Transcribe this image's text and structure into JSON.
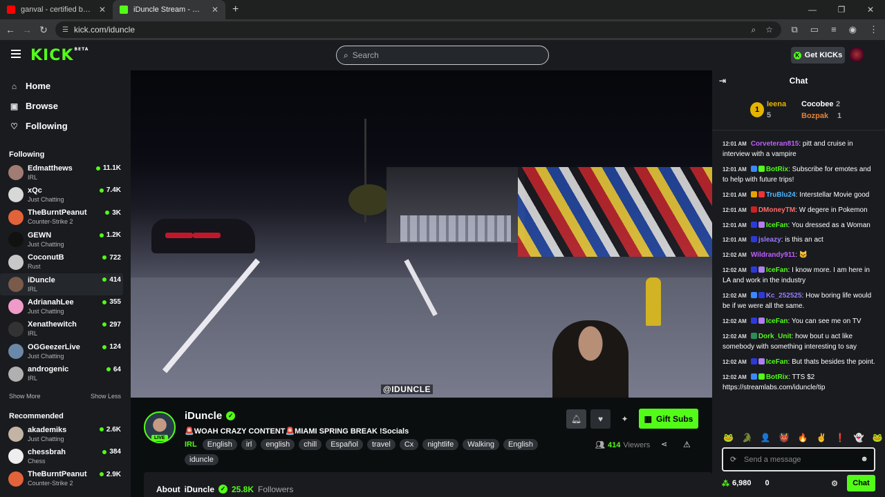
{
  "browser": {
    "tabs": [
      {
        "title": "ganval - certified boogeyman",
        "fav": "#ff0000"
      },
      {
        "title": "iDuncle Stream - Watch Live",
        "fav": "#53fc18"
      }
    ],
    "url": "kick.com/iduncle"
  },
  "header": {
    "logo": "KICK",
    "beta": "BETA",
    "search_placeholder": "Search",
    "get_kicks": "Get KICKs"
  },
  "sidebar": {
    "nav": [
      {
        "label": "Home",
        "icon": "home-icon"
      },
      {
        "label": "Browse",
        "icon": "browse-icon"
      },
      {
        "label": "Following",
        "icon": "heart-icon"
      }
    ],
    "following_title": "Following",
    "following": [
      {
        "name": "Edmatthews",
        "game": "IRL",
        "viewers": "11.1K",
        "color": "#a07c72"
      },
      {
        "name": "xQc",
        "game": "Just Chatting",
        "viewers": "7.4K",
        "color": "#d8d8d8"
      },
      {
        "name": "TheBurntPeanut",
        "game": "Counter-Strike 2",
        "viewers": "3K",
        "color": "#e2623a"
      },
      {
        "name": "GEWN",
        "game": "Just Chatting",
        "viewers": "1.2K",
        "color": "#111111"
      },
      {
        "name": "CoconutB",
        "game": "Rust",
        "viewers": "722",
        "color": "#c8c8c8"
      },
      {
        "name": "iDuncle",
        "game": "IRL",
        "viewers": "414",
        "color": "#7a5a4a"
      },
      {
        "name": "AdrianahLee",
        "game": "Just Chatting",
        "viewers": "355",
        "color": "#f09ac8"
      },
      {
        "name": "Xenathewitch",
        "game": "IRL",
        "viewers": "297",
        "color": "#333333"
      },
      {
        "name": "OGGeezerLive",
        "game": "Just Chatting",
        "viewers": "124",
        "color": "#6a88a8"
      },
      {
        "name": "androgenic",
        "game": "IRL",
        "viewers": "64",
        "color": "#b0b0b0"
      }
    ],
    "show_more": "Show More",
    "show_less": "Show Less",
    "recommended_title": "Recommended",
    "recommended": [
      {
        "name": "akademiks",
        "game": "Just Chatting",
        "viewers": "2.6K",
        "color": "#c4b4a4"
      },
      {
        "name": "chessbrah",
        "game": "Chess",
        "viewers": "384",
        "color": "#eeeeee"
      },
      {
        "name": "TheBurntPeanut",
        "game": "Counter-Strike 2",
        "viewers": "2.9K",
        "color": "#e2623a"
      }
    ]
  },
  "video": {
    "overlay_text": "@IDUNCLE"
  },
  "stream": {
    "name": "iDuncle",
    "live": "LIVE",
    "title": "🚨WOAH CRAZY CONTENT🚨MIAMI SPRING BREAK !Socials",
    "category": "IRL",
    "tags": [
      "English",
      "irl",
      "english",
      "chill",
      "Español",
      "travel",
      "Cx",
      "nightlife",
      "Walking",
      "English",
      "iduncle"
    ],
    "gift": "Gift Subs",
    "viewers": "414",
    "viewers_label": "Viewers",
    "about_prefix": "About",
    "about_name": "iDuncle",
    "followers": "25.8K",
    "followers_label": "Followers"
  },
  "chat": {
    "title": "Chat",
    "leaderboard": [
      {
        "rank": "1",
        "name": "Ieena",
        "count": "5"
      },
      {
        "name": "Cocobee",
        "count": "2"
      },
      {
        "name": "Bozpak",
        "count": "1"
      }
    ],
    "messages": [
      {
        "time": "12:01 AM",
        "user": "Corveteran815",
        "color": "#c05dff",
        "text": ": pitt and cruise in interview with a vampire",
        "badges": []
      },
      {
        "time": "12:01 AM",
        "user": "BotRix",
        "color": "#53fc18",
        "text": ": Subscribe for emotes and to help with future trips!",
        "badges": [
          "#3b88ff",
          "#53fc18"
        ]
      },
      {
        "time": "12:01 AM",
        "user": "TruBlu24",
        "color": "#4fb6ff",
        "text": ": Interstellar Movie good",
        "badges": [
          "#e6a100",
          "#e33"
        ]
      },
      {
        "time": "12:01 AM",
        "user": "DMoneyTM",
        "color": "#ff6b6b",
        "text": ": W degere in Pokemon",
        "badges": [
          "#c22"
        ]
      },
      {
        "time": "12:01 AM",
        "user": "IceFan",
        "color": "#53fc18",
        "text": ": You dressed as a Woman",
        "badges": [
          "#2c3bd8",
          "#b07ef0"
        ]
      },
      {
        "time": "12:01 AM",
        "user": "jsleazy",
        "color": "#9a7bff",
        "text": ": is this an act",
        "badges": [
          "#2c3bd8"
        ]
      },
      {
        "time": "12:02 AM",
        "user": "Wildrandy911",
        "color": "#c05dff",
        "text": ": 🐱",
        "badges": []
      },
      {
        "time": "12:02 AM",
        "user": "IceFan",
        "color": "#53fc18",
        "text": ": I know more. I am here in LA and work in the industry",
        "badges": [
          "#2c3bd8",
          "#b07ef0"
        ]
      },
      {
        "time": "12:02 AM",
        "user": "Kc_252525",
        "color": "#9a7bff",
        "text": ": How boring life would be if we were all the same.",
        "badges": [
          "#3b88ff",
          "#2c3bd8"
        ]
      },
      {
        "time": "12:02 AM",
        "user": "IceFan",
        "color": "#53fc18",
        "text": ": You can see me on TV",
        "badges": [
          "#2c3bd8",
          "#b07ef0"
        ]
      },
      {
        "time": "12:02 AM",
        "user": "Dork_Unit",
        "color": "#53fc18",
        "text": ": how bout u act like somebody with something interesting to say",
        "badges": [
          "#2c8d5a"
        ]
      },
      {
        "time": "12:02 AM",
        "user": "IceFan",
        "color": "#53fc18",
        "text": ": But thats besides the point.",
        "badges": [
          "#2c3bd8",
          "#b07ef0"
        ]
      },
      {
        "time": "12:02 AM",
        "user": "BotRix",
        "color": "#53fc18",
        "text": ": TTS $2 https://streamlabs.com/iduncle/tip",
        "badges": [
          "#3b88ff",
          "#53fc18"
        ]
      }
    ],
    "input_placeholder": "Send a message",
    "points": "6,980",
    "kicks": "0",
    "send": "Chat"
  }
}
